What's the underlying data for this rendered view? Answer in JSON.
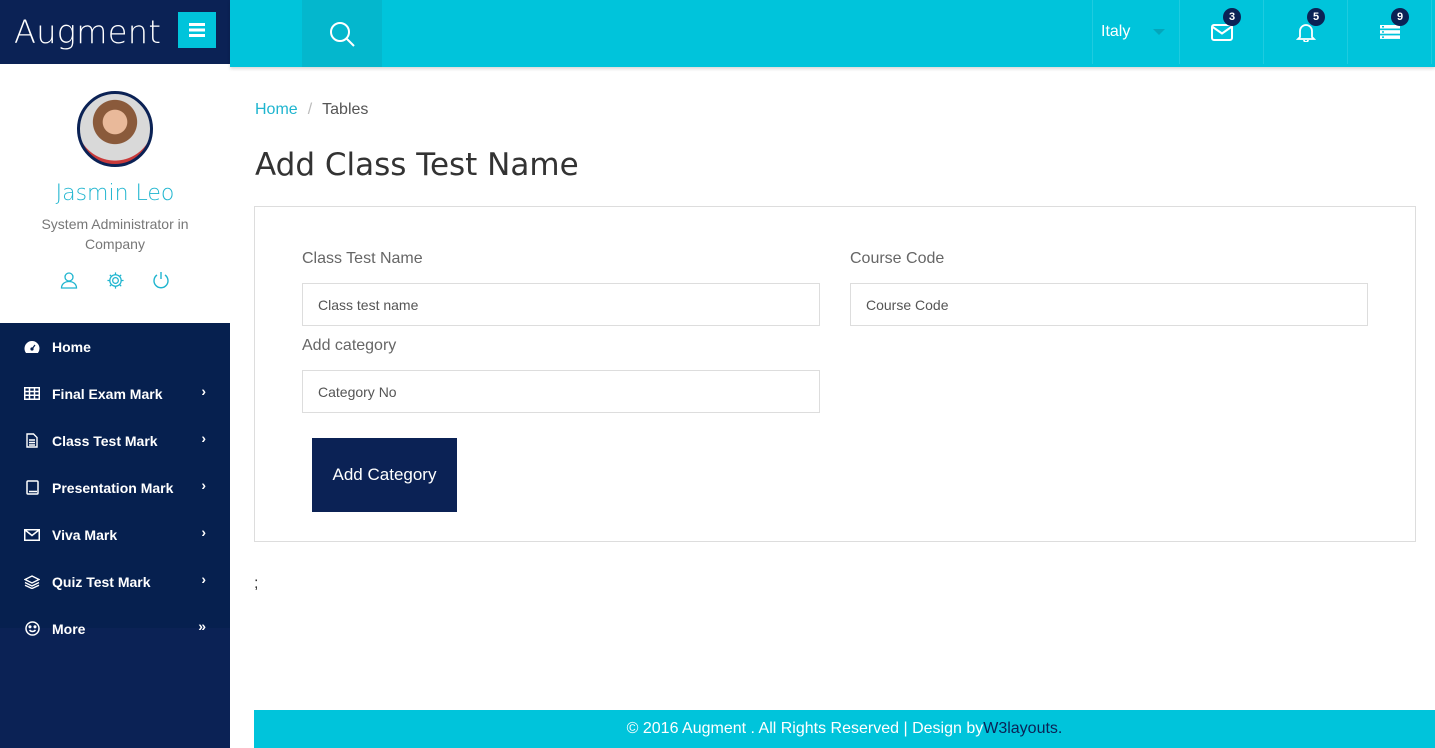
{
  "app": {
    "brand": "Augment"
  },
  "profile": {
    "name": "Jasmin Leo",
    "role": "System Administrator in Company"
  },
  "sidebar": {
    "items": [
      {
        "label": "Home",
        "icon": "dashboard-icon",
        "has_chevron": false
      },
      {
        "label": "Final Exam Mark",
        "icon": "table-icon",
        "has_chevron": true
      },
      {
        "label": "Class Test Mark",
        "icon": "file-icon",
        "has_chevron": true
      },
      {
        "label": "Presentation Mark",
        "icon": "book-icon",
        "has_chevron": true
      },
      {
        "label": "Viva Mark",
        "icon": "envelope-icon",
        "has_chevron": true
      },
      {
        "label": "Quiz Test Mark",
        "icon": "layers-icon",
        "has_chevron": true
      },
      {
        "label": "More",
        "icon": "smile-icon",
        "has_chevron": true
      }
    ]
  },
  "topbar": {
    "language": "Italy",
    "mail_count": "3",
    "notification_count": "5",
    "tasks_count": "9"
  },
  "breadcrumb": {
    "home": "Home",
    "separator": "/",
    "current": "Tables"
  },
  "page": {
    "title": "Add Class Test Name"
  },
  "form": {
    "class_test_name_label": "Class Test Name",
    "class_test_name_placeholder": "Class test name",
    "course_code_label": "Course Code",
    "course_code_placeholder": "Course Code",
    "category_label": "Add category",
    "category_placeholder": "Category No",
    "submit_label": "Add Category"
  },
  "stray_text": ";",
  "footer": {
    "text": "© 2016 Augment . All Rights Reserved | Design by ",
    "link": "W3layouts."
  },
  "colors": {
    "accent": "#00c4db",
    "navy": "#0b2255",
    "name_color": "#1fb5cf"
  }
}
